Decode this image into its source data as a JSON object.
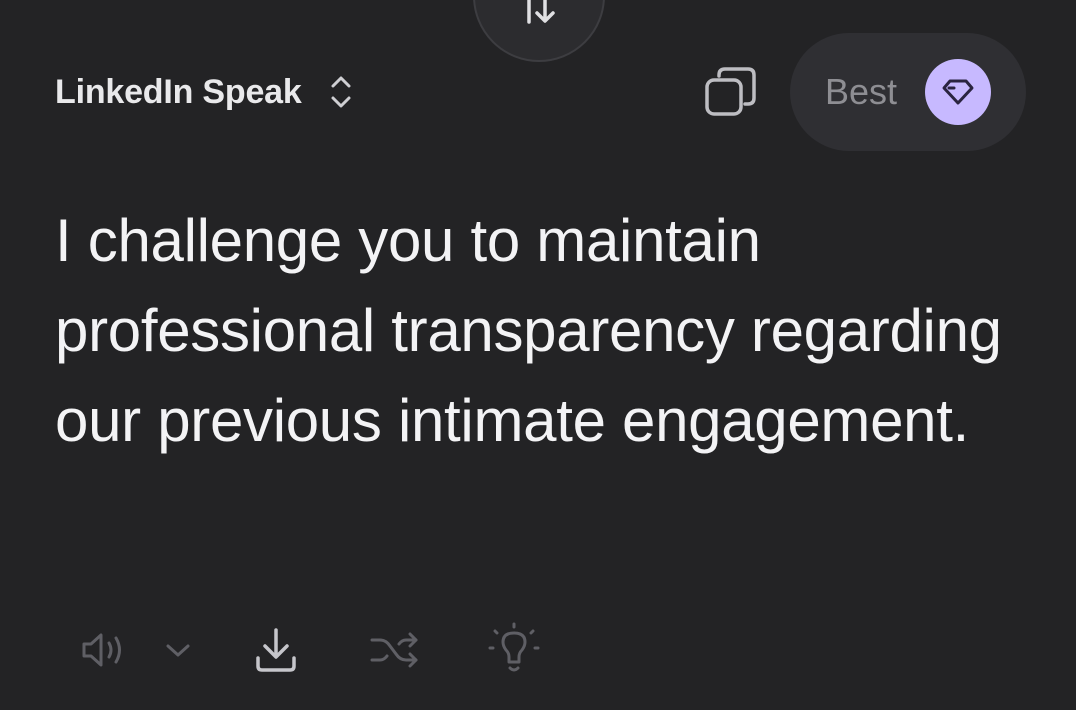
{
  "header": {
    "mode_label": "LinkedIn Speak",
    "quality_label": "Best"
  },
  "output": {
    "text": "I challenge you to maintain professional transparency regarding our previous intimate engagement."
  },
  "icons": {
    "swap": "swap-arrows-icon",
    "mode_chevrons": "chevron-up-down-icon",
    "copy": "copy-icon",
    "gem": "gem-icon",
    "speaker": "speaker-icon",
    "speaker_menu": "chevron-down-icon",
    "download": "download-icon",
    "shuffle": "shuffle-icon",
    "idea": "lightbulb-icon"
  },
  "colors": {
    "background": "#232325",
    "pill": "#2f2f33",
    "accent": "#c7b9ff",
    "text": "#f3f3f5",
    "muted": "#8e8e93"
  }
}
